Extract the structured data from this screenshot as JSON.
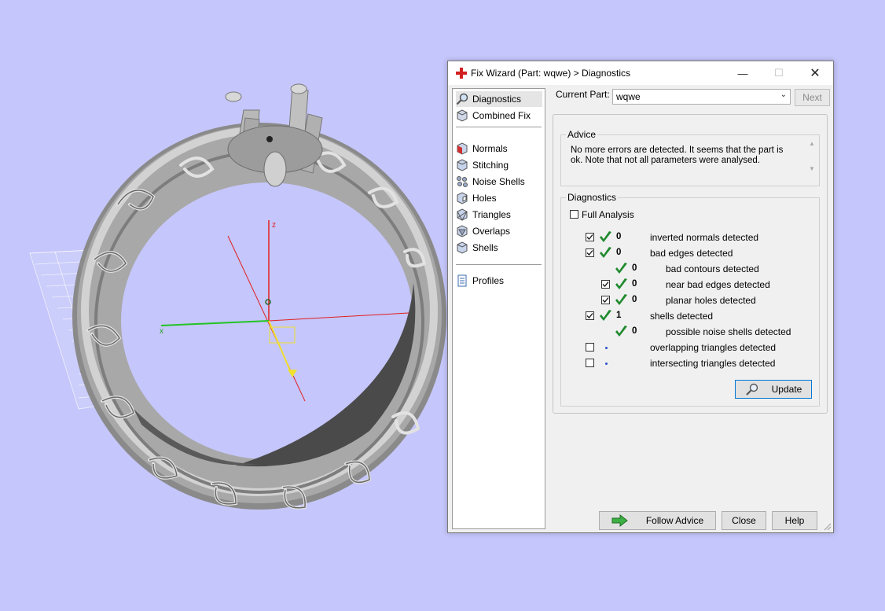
{
  "dialog": {
    "title": "Fix Wizard (Part: wqwe) > Diagnostics",
    "controls": {
      "minimize": "—",
      "maximize": "☐",
      "close": "✕"
    }
  },
  "viewport": {
    "axes": {
      "x": "x",
      "z": "z"
    },
    "model": "ring"
  },
  "nav": {
    "items": [
      {
        "label": "Diagnostics",
        "icon": "magnifier-icon",
        "selected": true
      },
      {
        "label": "Combined Fix",
        "icon": "cube-icon"
      },
      {
        "label": "Normals",
        "icon": "normals-cube-icon"
      },
      {
        "label": "Stitching",
        "icon": "stitching-cube-icon"
      },
      {
        "label": "Noise Shells",
        "icon": "noise-shells-icon"
      },
      {
        "label": "Holes",
        "icon": "holes-cube-icon"
      },
      {
        "label": "Triangles",
        "icon": "triangles-cube-icon"
      },
      {
        "label": "Overlaps",
        "icon": "overlaps-cube-icon"
      },
      {
        "label": "Shells",
        "icon": "shells-cube-icon"
      },
      {
        "label": "Profiles",
        "icon": "document-icon"
      }
    ]
  },
  "current_part": {
    "label": "Current Part:",
    "value": "wqwe",
    "next_label": "Next"
  },
  "advice": {
    "title": "Advice",
    "text": "No more errors are detected. It seems that the part is ok. Note that not all parameters were analysed."
  },
  "diagnostics": {
    "title": "Diagnostics",
    "full_analysis": {
      "label": "Full Analysis",
      "checked": false
    },
    "rows": [
      {
        "checkbox": true,
        "checked": true,
        "status": "ok",
        "count": "0",
        "label": "inverted normals detected",
        "indent": 0
      },
      {
        "checkbox": true,
        "checked": true,
        "status": "ok",
        "count": "0",
        "label": "bad edges detected",
        "indent": 0
      },
      {
        "checkbox": false,
        "checked": false,
        "status": "ok",
        "count": "0",
        "label": "bad contours detected",
        "indent": 1
      },
      {
        "checkbox": true,
        "checked": true,
        "status": "ok",
        "count": "0",
        "label": "near bad edges detected",
        "indent": 1
      },
      {
        "checkbox": true,
        "checked": true,
        "status": "ok",
        "count": "0",
        "label": "planar holes detected",
        "indent": 1
      },
      {
        "checkbox": true,
        "checked": true,
        "status": "ok",
        "count": "1",
        "label": "shells detected",
        "indent": 0
      },
      {
        "checkbox": false,
        "checked": false,
        "status": "ok",
        "count": "0",
        "label": "possible noise shells detected",
        "indent": 1
      },
      {
        "checkbox": true,
        "checked": false,
        "status": "unknown",
        "count": "",
        "label": "overlapping triangles detected",
        "indent": 0
      },
      {
        "checkbox": true,
        "checked": false,
        "status": "unknown",
        "count": "",
        "label": "intersecting triangles detected",
        "indent": 0
      }
    ],
    "update_label": "Update"
  },
  "buttons": {
    "follow_advice": "Follow Advice",
    "close": "Close",
    "help": "Help"
  },
  "colors": {
    "background": "#c5c6fb",
    "check_green": "#1f8a2e",
    "accent": "#0078d7",
    "title_icon": "#d21f1f"
  }
}
